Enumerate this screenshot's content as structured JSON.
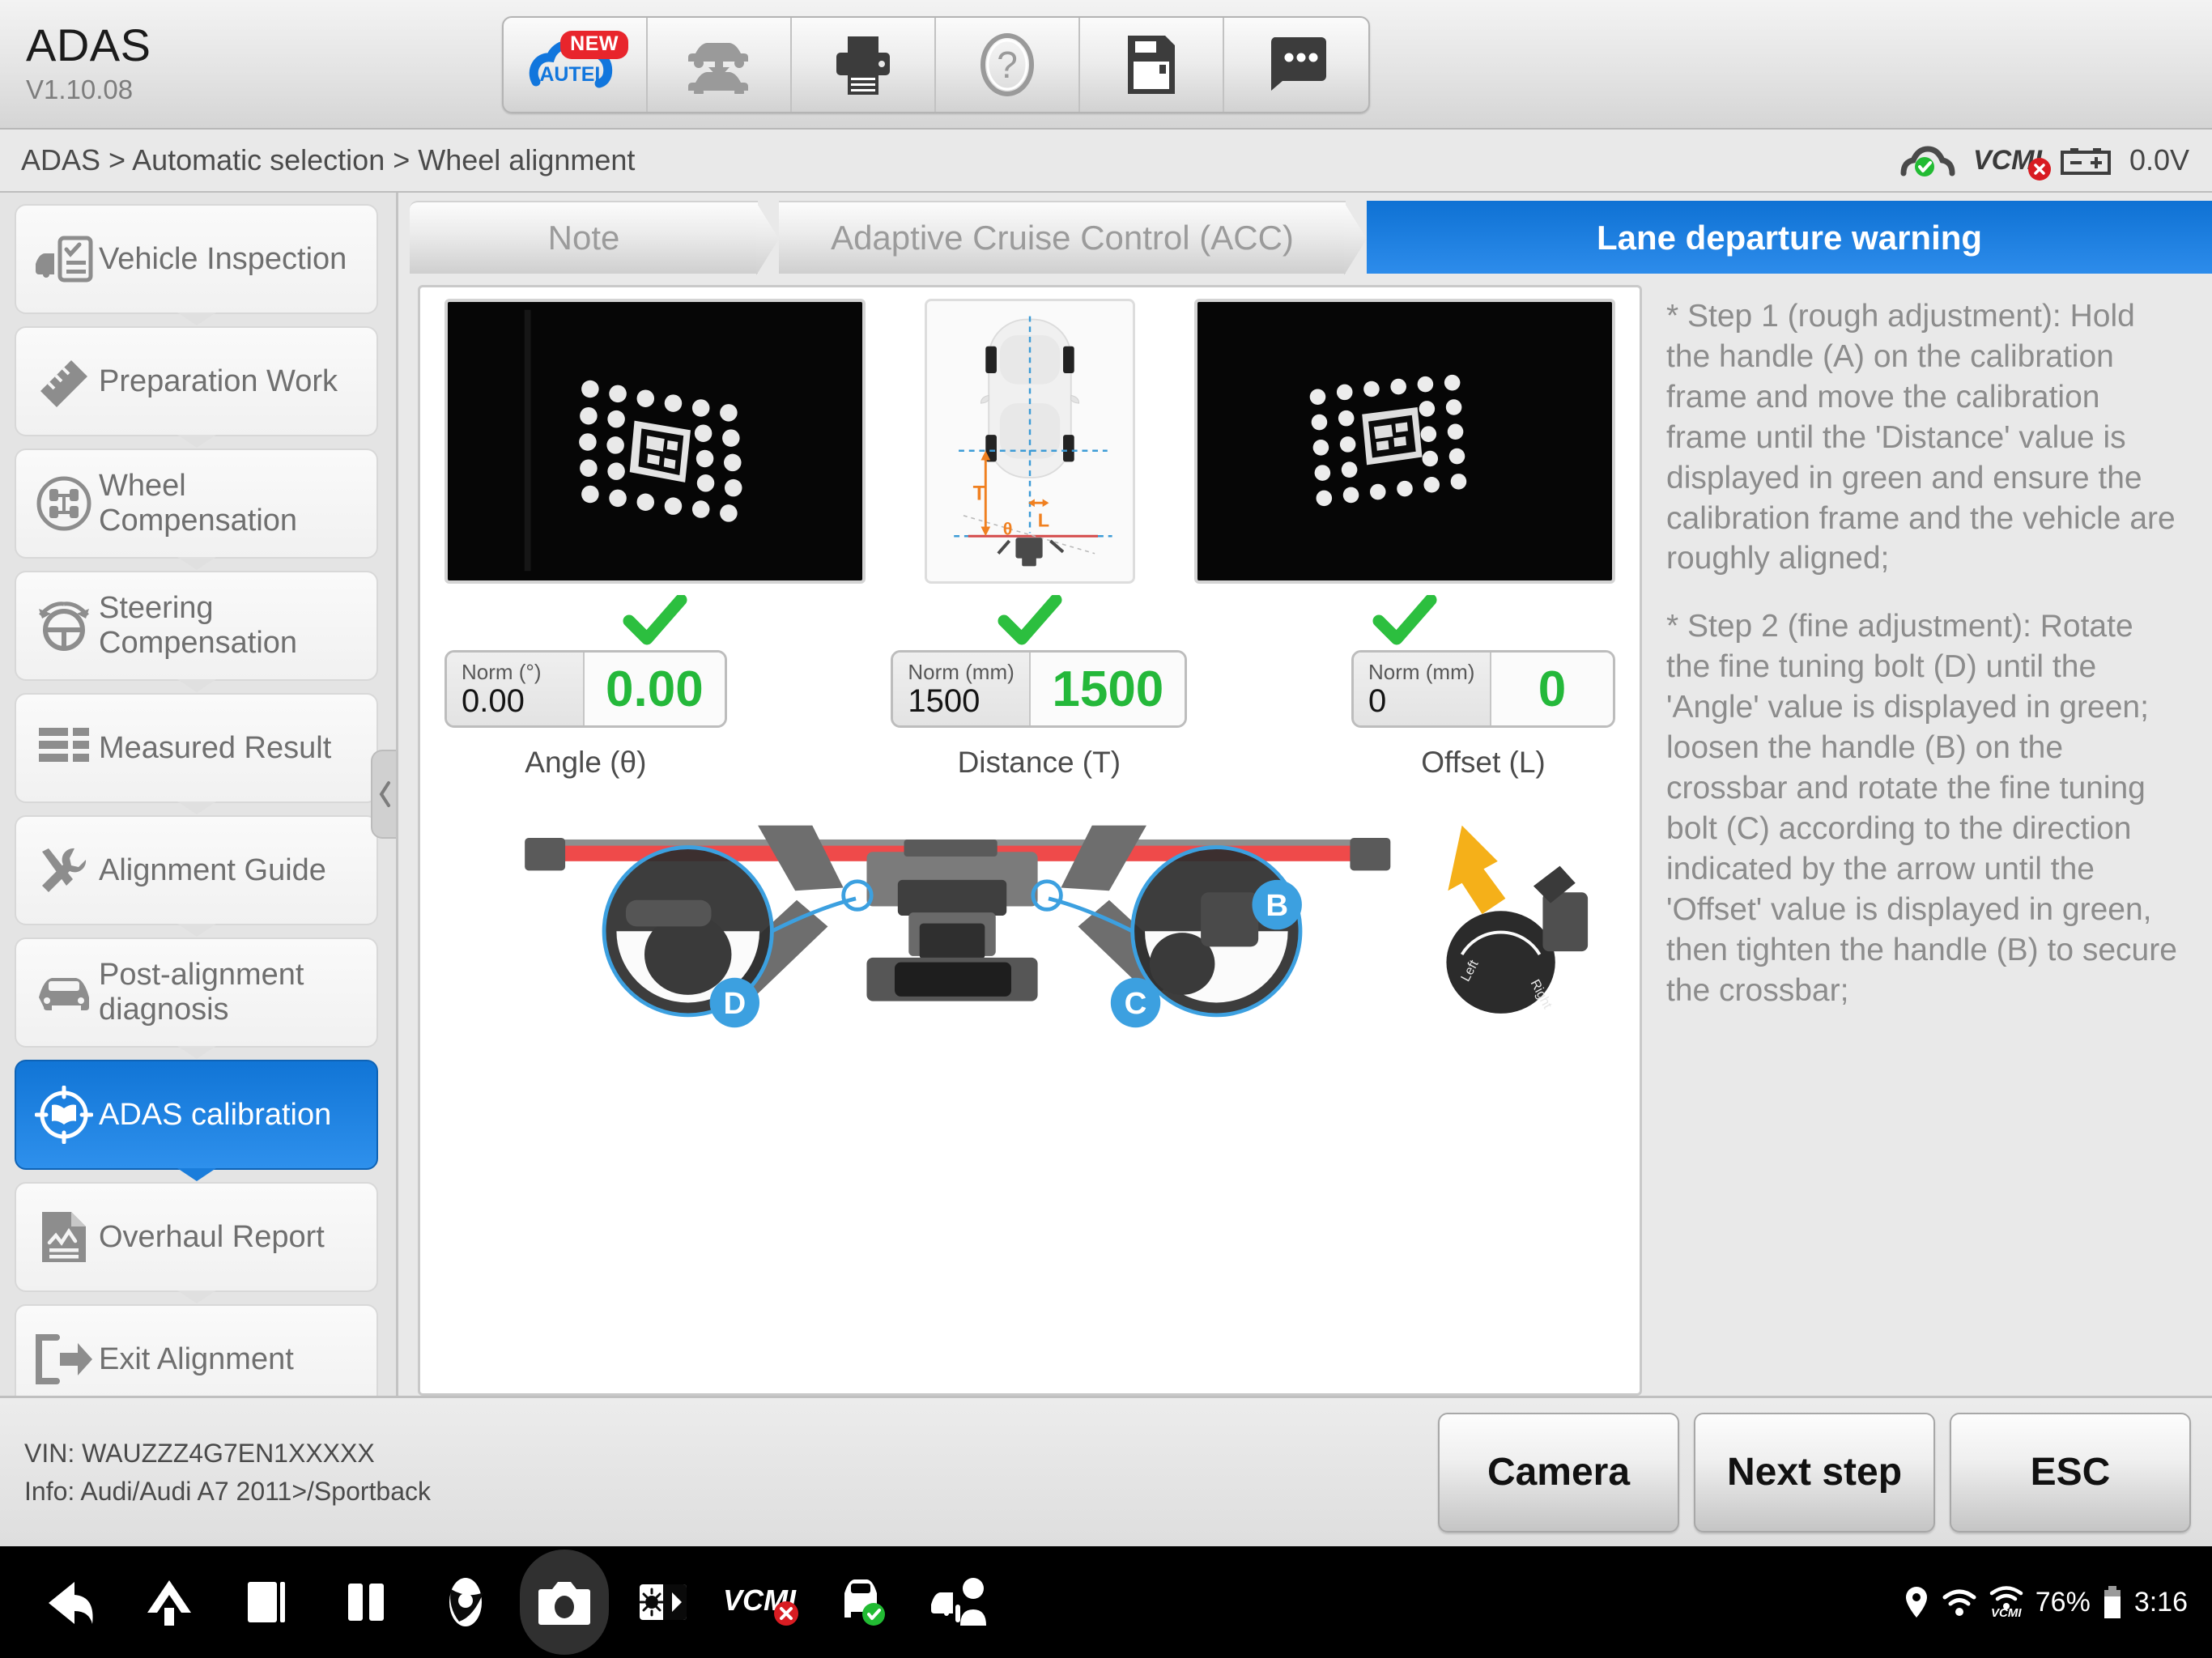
{
  "header": {
    "app_title": "ADAS",
    "version": "V1.10.08",
    "toolbar": [
      {
        "name": "autel-cloud-icon",
        "label": "AUTEL",
        "badge": "NEW"
      },
      {
        "name": "vehicle-download-icon",
        "label": ""
      },
      {
        "name": "print-icon",
        "label": ""
      },
      {
        "name": "help-icon",
        "label": ""
      },
      {
        "name": "save-icon",
        "label": ""
      },
      {
        "name": "feedback-icon",
        "label": ""
      }
    ]
  },
  "breadcrumb": {
    "text": "ADAS > Automatic selection > Wheel alignment",
    "connection_label": "VCMI",
    "voltage": "0.0V"
  },
  "sidebar": {
    "items": [
      {
        "label": "Vehicle Inspection",
        "icon": "vehicle-inspection-icon",
        "active": false
      },
      {
        "label": "Preparation Work",
        "icon": "ruler-icon",
        "active": false
      },
      {
        "label": "Wheel Compensation",
        "icon": "wheel-compensation-icon",
        "active": false
      },
      {
        "label": "Steering Compensation",
        "icon": "steering-wheel-icon",
        "active": false
      },
      {
        "label": "Measured Result",
        "icon": "list-icon",
        "active": false
      },
      {
        "label": "Alignment Guide",
        "icon": "tools-icon",
        "active": false
      },
      {
        "label": "Post-alignment diagnosis",
        "icon": "car-icon",
        "active": false
      },
      {
        "label": "ADAS calibration",
        "icon": "target-book-icon",
        "active": true
      },
      {
        "label": "Overhaul Report",
        "icon": "report-icon",
        "active": false
      },
      {
        "label": "Exit Alignment",
        "icon": "exit-icon",
        "active": false
      }
    ]
  },
  "tabs": [
    {
      "label": "Note",
      "active": false
    },
    {
      "label": "Adaptive Cruise Control (ACC)",
      "active": false
    },
    {
      "label": "Lane departure warning",
      "active": true
    }
  ],
  "measurements": [
    {
      "caption": "Angle (θ)",
      "norm_label": "Norm (°)",
      "norm_value": "0.00",
      "current_value": "0.00",
      "status": "ok",
      "color": "#24b83a"
    },
    {
      "caption": "Distance (T)",
      "norm_label": "Norm (mm)",
      "norm_value": "1500",
      "current_value": "1500",
      "status": "ok",
      "color": "#24b83a"
    },
    {
      "caption": "Offset (L)",
      "norm_label": "Norm (mm)",
      "norm_value": "0",
      "current_value": "0",
      "status": "ok",
      "color": "#24b83a"
    }
  ],
  "diagram": {
    "labels": [
      "T",
      "L",
      "θ"
    ],
    "callouts": [
      "B",
      "C",
      "D"
    ],
    "dial_left": "Left",
    "dial_right": "Right"
  },
  "instructions": [
    "* Step 1 (rough adjustment): Hold the handle (A) on the calibration frame and move the calibration frame until the 'Distance' value is displayed in green and ensure the calibration frame and the vehicle are roughly aligned;",
    "* Step 2 (fine adjustment): Rotate the fine tuning bolt (D) until the 'Angle' value is displayed in green; loosen the handle (B) on the crossbar and rotate the fine tuning bolt (C) according to the direction indicated by the arrow until the 'Offset' value is displayed in green, then tighten the handle (B) to secure the crossbar;"
  ],
  "footer": {
    "vin": "VIN: WAUZZZ4G7EN1XXXXX",
    "info": "Info: Audi/Audi A7 2011>/Sportback",
    "buttons": [
      {
        "label": "Camera",
        "name": "camera-button"
      },
      {
        "label": "Next step",
        "name": "next-step-button"
      },
      {
        "label": "ESC",
        "name": "esc-button"
      }
    ]
  },
  "navbar": {
    "buttons": [
      {
        "name": "back-icon"
      },
      {
        "name": "home-icon"
      },
      {
        "name": "recents-icon"
      },
      {
        "name": "split-screen-icon"
      },
      {
        "name": "chrome-icon"
      },
      {
        "name": "camera-icon"
      },
      {
        "name": "brightness-icon"
      },
      {
        "name": "vcmi-icon"
      },
      {
        "name": "vehicle-ok-icon"
      },
      {
        "name": "remote-support-icon"
      }
    ],
    "status": {
      "battery_percent": "76%",
      "clock": "3:16",
      "vcmi_wifi_label": "VCMI"
    }
  },
  "colors": {
    "accent": "#1175d6",
    "ok_green": "#24b83a",
    "alert_red": "#e8252c"
  }
}
